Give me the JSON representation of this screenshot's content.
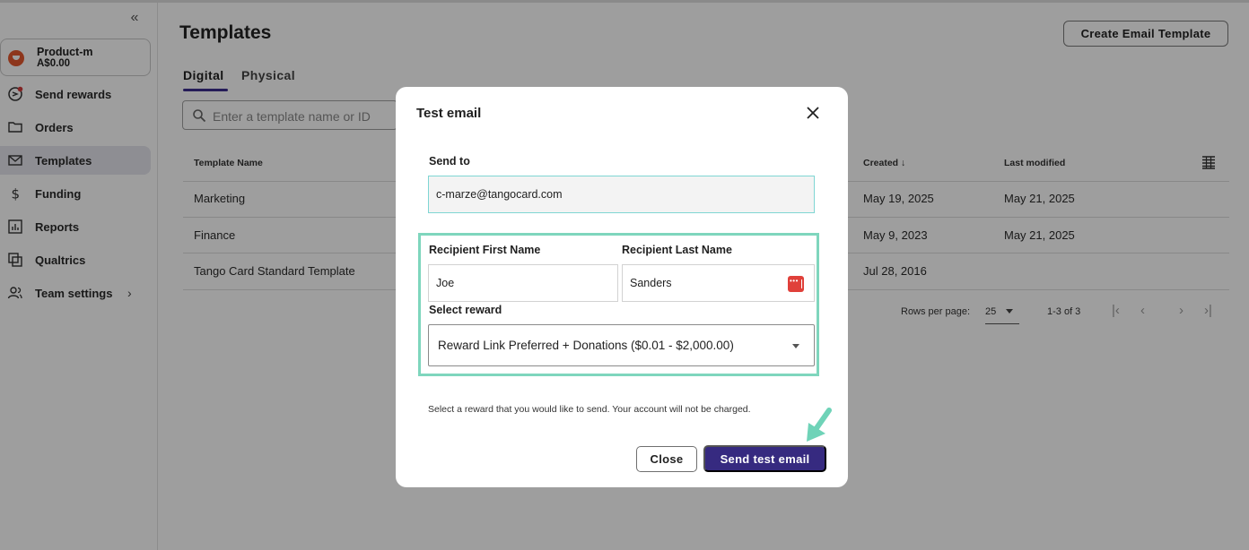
{
  "colors": {
    "accent": "#362a80",
    "highlight": "#7fd6bd",
    "input_focus": "#7fd6d3",
    "danger": "#e0403a",
    "brand": "#e4572e"
  },
  "sidebar": {
    "collapse_icon": "double-chevron-left-icon",
    "account": {
      "name": "Product-m",
      "balance": "A$0.00"
    },
    "items": [
      {
        "label": "Send rewards",
        "icon": "send-rewards-icon"
      },
      {
        "label": "Orders",
        "icon": "folder-icon"
      },
      {
        "label": "Templates",
        "icon": "mail-icon",
        "active": true
      },
      {
        "label": "Funding",
        "icon": "dollar-icon"
      },
      {
        "label": "Reports",
        "icon": "chart-icon"
      },
      {
        "label": "Qualtrics",
        "icon": "qualtrics-icon"
      },
      {
        "label": "Team settings",
        "icon": "team-icon",
        "chevron": "chevron-right-icon"
      }
    ]
  },
  "main": {
    "title": "Templates",
    "create_button": "Create Email Template",
    "tabs": [
      {
        "label": "Digital",
        "active": true
      },
      {
        "label": "Physical"
      }
    ],
    "search": {
      "placeholder": "Enter a template name or ID"
    },
    "table": {
      "headers": [
        "Template Name",
        "Created",
        "Last modified"
      ],
      "rows": [
        {
          "name": "Marketing",
          "created": "May 19, 2025",
          "modified": "May 21, 2025"
        },
        {
          "name": "Finance",
          "created": "May 9, 2023",
          "modified": "May 21, 2025"
        },
        {
          "name": "Tango Card Standard Template",
          "created": "Jul 28, 2016",
          "modified": ""
        }
      ]
    },
    "pagination": {
      "rows_per_page_label": "Rows per page:",
      "rows_per_page_value": "25",
      "range": "1-3 of 3"
    }
  },
  "modal": {
    "title": "Test email",
    "send_to_label": "Send to",
    "send_to_value": "c-marze@tangocard.com",
    "first_name_label": "Recipient First Name",
    "first_name_value": "Joe",
    "last_name_label": "Recipient Last Name",
    "last_name_value": "Sanders",
    "reward_label": "Select reward",
    "reward_value": "Reward Link Preferred + Donations ($0.01 - $2,000.00)",
    "helper_text": "Select a reward that you would like to send. Your account will not be charged.",
    "close_button": "Close",
    "send_button": "Send test email"
  }
}
